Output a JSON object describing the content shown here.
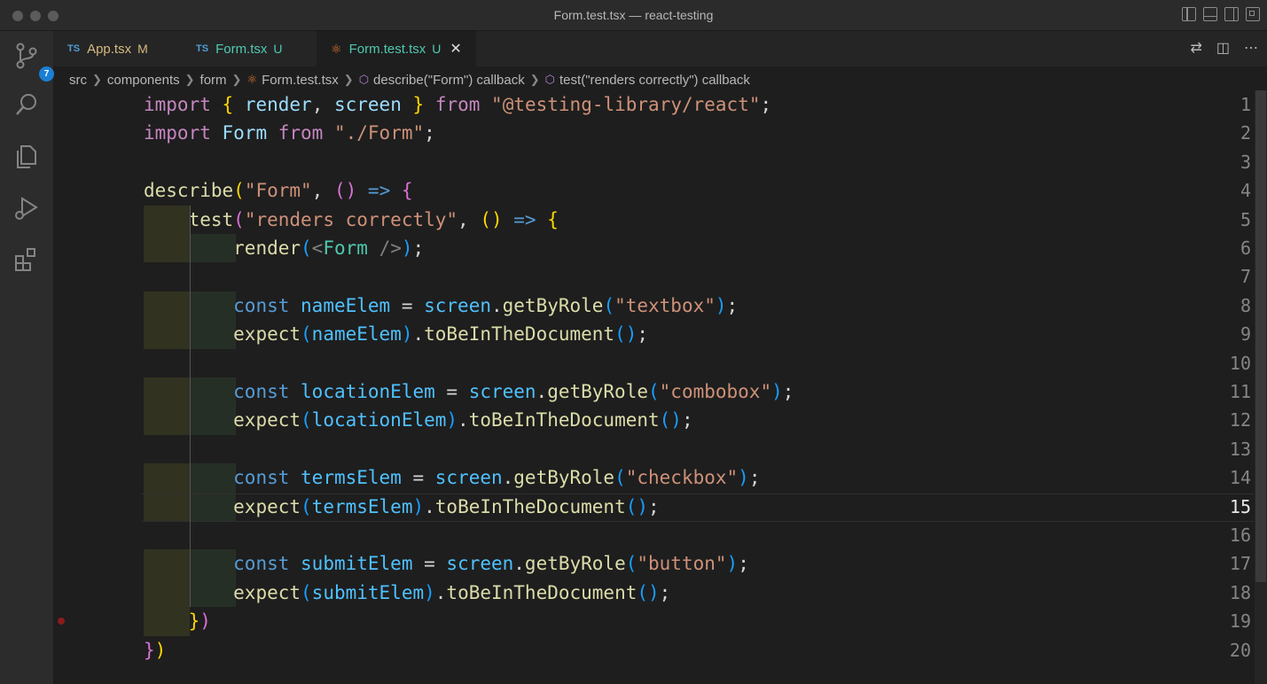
{
  "window": {
    "title": "Form.test.tsx — react-testing"
  },
  "activity": {
    "source_control_badge": "7"
  },
  "tabs": [
    {
      "type": "TS",
      "label": "App.tsx",
      "status": "M",
      "label_color": "#d7ba7d",
      "status_color": "#d7ba7d"
    },
    {
      "type": "TS",
      "label": "Form.tsx",
      "status": "U",
      "label_color": "#4ec9b0",
      "status_color": "#4ec9b0"
    },
    {
      "type": "react",
      "label": "Form.test.tsx",
      "status": "U",
      "label_color": "#4ec9b0",
      "status_color": "#4ec9b0",
      "active": true
    }
  ],
  "breadcrumb": [
    "src",
    "components",
    "form",
    "Form.test.tsx",
    "describe(\"Form\") callback",
    "test(\"renders correctly\") callback"
  ],
  "editor": {
    "current_line": 15,
    "breakpoint_line": 19,
    "lines": [
      [
        [
          "kw",
          "import"
        ],
        [
          "txt",
          " "
        ],
        [
          "br1",
          "{"
        ],
        [
          "txt",
          " "
        ],
        [
          "vr",
          "render"
        ],
        [
          "txt",
          ", "
        ],
        [
          "vr",
          "screen"
        ],
        [
          "txt",
          " "
        ],
        [
          "br1",
          "}"
        ],
        [
          "txt",
          " "
        ],
        [
          "kw",
          "from"
        ],
        [
          "txt",
          " "
        ],
        [
          "str",
          "\"@testing-library/react\""
        ],
        [
          "txt",
          ";"
        ]
      ],
      [
        [
          "kw",
          "import"
        ],
        [
          "txt",
          " "
        ],
        [
          "vr",
          "Form"
        ],
        [
          "txt",
          " "
        ],
        [
          "kw",
          "from"
        ],
        [
          "txt",
          " "
        ],
        [
          "str",
          "\"./Form\""
        ],
        [
          "txt",
          ";"
        ]
      ],
      [],
      [
        [
          "fn",
          "describe"
        ],
        [
          "br1",
          "("
        ],
        [
          "str",
          "\"Form\""
        ],
        [
          "txt",
          ", "
        ],
        [
          "br2",
          "()"
        ],
        [
          "txt",
          " "
        ],
        [
          "kb",
          "=>"
        ],
        [
          "txt",
          " "
        ],
        [
          "br2",
          "{"
        ]
      ],
      [
        [
          "txt",
          "    "
        ],
        [
          "fn",
          "test"
        ],
        [
          "br2",
          "("
        ],
        [
          "str",
          "\"renders correctly\""
        ],
        [
          "txt",
          ", "
        ],
        [
          "br1",
          "()"
        ],
        [
          "txt",
          " "
        ],
        [
          "kb",
          "=>"
        ],
        [
          "txt",
          " "
        ],
        [
          "br1",
          "{"
        ]
      ],
      [
        [
          "txt",
          "        "
        ],
        [
          "fn",
          "render"
        ],
        [
          "br3",
          "("
        ],
        [
          "punc",
          "<"
        ],
        [
          "tag",
          "Form"
        ],
        [
          "txt",
          " "
        ],
        [
          "punc",
          "/>"
        ],
        [
          "br3",
          ")"
        ],
        [
          "txt",
          ";"
        ]
      ],
      [],
      [
        [
          "txt",
          "        "
        ],
        [
          "kb",
          "const"
        ],
        [
          "txt",
          " "
        ],
        [
          "var",
          "nameElem"
        ],
        [
          "txt",
          " = "
        ],
        [
          "var",
          "screen"
        ],
        [
          "txt",
          "."
        ],
        [
          "fn",
          "getByRole"
        ],
        [
          "br3",
          "("
        ],
        [
          "str",
          "\"textbox\""
        ],
        [
          "br3",
          ")"
        ],
        [
          "txt",
          ";"
        ]
      ],
      [
        [
          "txt",
          "        "
        ],
        [
          "fn",
          "expect"
        ],
        [
          "br3",
          "("
        ],
        [
          "var",
          "nameElem"
        ],
        [
          "br3",
          ")"
        ],
        [
          "txt",
          "."
        ],
        [
          "fn",
          "toBeInTheDocument"
        ],
        [
          "br3",
          "()"
        ],
        [
          "txt",
          ";"
        ]
      ],
      [],
      [
        [
          "txt",
          "        "
        ],
        [
          "kb",
          "const"
        ],
        [
          "txt",
          " "
        ],
        [
          "var",
          "locationElem"
        ],
        [
          "txt",
          " = "
        ],
        [
          "var",
          "screen"
        ],
        [
          "txt",
          "."
        ],
        [
          "fn",
          "getByRole"
        ],
        [
          "br3",
          "("
        ],
        [
          "str",
          "\"combobox\""
        ],
        [
          "br3",
          ")"
        ],
        [
          "txt",
          ";"
        ]
      ],
      [
        [
          "txt",
          "        "
        ],
        [
          "fn",
          "expect"
        ],
        [
          "br3",
          "("
        ],
        [
          "var",
          "locationElem"
        ],
        [
          "br3",
          ")"
        ],
        [
          "txt",
          "."
        ],
        [
          "fn",
          "toBeInTheDocument"
        ],
        [
          "br3",
          "()"
        ],
        [
          "txt",
          ";"
        ]
      ],
      [],
      [
        [
          "txt",
          "        "
        ],
        [
          "kb",
          "const"
        ],
        [
          "txt",
          " "
        ],
        [
          "var",
          "termsElem"
        ],
        [
          "txt",
          " = "
        ],
        [
          "var",
          "screen"
        ],
        [
          "txt",
          "."
        ],
        [
          "fn",
          "getByRole"
        ],
        [
          "br3",
          "("
        ],
        [
          "str",
          "\"checkbox\""
        ],
        [
          "br3",
          ")"
        ],
        [
          "txt",
          ";"
        ]
      ],
      [
        [
          "txt",
          "        "
        ],
        [
          "fn",
          "expect"
        ],
        [
          "br3",
          "("
        ],
        [
          "var",
          "termsElem"
        ],
        [
          "br3",
          ")"
        ],
        [
          "txt",
          "."
        ],
        [
          "fn",
          "toBeInTheDocument"
        ],
        [
          "br3",
          "()"
        ],
        [
          "txt",
          ";"
        ]
      ],
      [],
      [
        [
          "txt",
          "        "
        ],
        [
          "kb",
          "const"
        ],
        [
          "txt",
          " "
        ],
        [
          "var",
          "submitElem"
        ],
        [
          "txt",
          " = "
        ],
        [
          "var",
          "screen"
        ],
        [
          "txt",
          "."
        ],
        [
          "fn",
          "getByRole"
        ],
        [
          "br3",
          "("
        ],
        [
          "str",
          "\"button\""
        ],
        [
          "br3",
          ")"
        ],
        [
          "txt",
          ";"
        ]
      ],
      [
        [
          "txt",
          "        "
        ],
        [
          "fn",
          "expect"
        ],
        [
          "br3",
          "("
        ],
        [
          "var",
          "submitElem"
        ],
        [
          "br3",
          ")"
        ],
        [
          "txt",
          "."
        ],
        [
          "fn",
          "toBeInTheDocument"
        ],
        [
          "br3",
          "()"
        ],
        [
          "txt",
          ";"
        ]
      ],
      [
        [
          "txt",
          "    "
        ],
        [
          "br1",
          "}"
        ],
        [
          "br2",
          ")"
        ]
      ],
      [
        [
          "br2",
          "}"
        ],
        [
          "br1",
          ")"
        ]
      ]
    ]
  }
}
